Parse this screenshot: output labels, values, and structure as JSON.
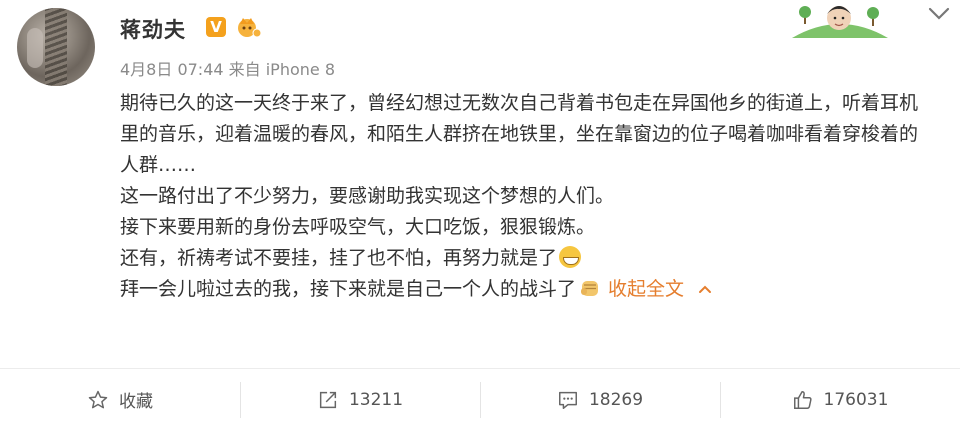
{
  "post": {
    "author": "蒋劲夫",
    "verified_badge": "V",
    "meta": "4月8日 07:44 来自 iPhone 8",
    "paragraphs": [
      "期待已久的这一天终于来了，曾经幻想过无数次自己背着书包走在异国他乡的街道上，听着耳机里的音乐，迎着温暖的春风，和陌生人群挤在地铁里，坐在靠窗边的位子喝着咖啡看着穿梭着的人群……",
      "这一路付出了不少努力，要感谢助我实现这个梦想的人们。",
      "接下来要用新的身份去呼吸空气，大口吃饭，狠狠锻炼。",
      "还有，祈祷考试不要挂，挂了也不怕，再努力就是了",
      "拜一会儿啦过去的我，接下来就是自己一个人的战斗了"
    ],
    "collapse_label": "收起全文"
  },
  "actions": {
    "favorite": "收藏",
    "repost": "13211",
    "comment": "18269",
    "like": "176031"
  },
  "colors": {
    "accent": "#e57e2e",
    "badge": "#f4a11d",
    "text": "#333333",
    "muted": "#8a8a8a"
  }
}
